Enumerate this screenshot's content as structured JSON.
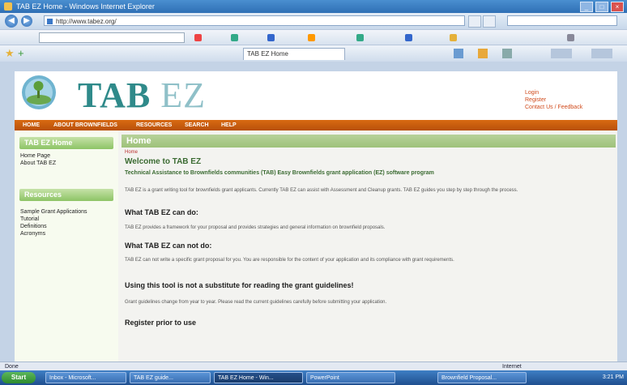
{
  "browser": {
    "title": "TAB EZ Home - Windows Internet Explorer",
    "address": "http://www.tabez.org/",
    "search_text": "",
    "google_query": "",
    "tab_title": "TAB EZ Home",
    "status_text": "Done",
    "zone_text": "Internet"
  },
  "site": {
    "brand_tab": "TAB",
    "brand_ez": "EZ",
    "top_links": [
      "Login",
      "Register",
      "Contact Us / Feedback"
    ],
    "nav": [
      "HOME",
      "ABOUT BROWNFIELDS",
      "RESOURCES",
      "SEARCH",
      "HELP"
    ]
  },
  "sidebar": {
    "section1_title": "TAB EZ Home",
    "section1_links": [
      "Home Page",
      "About TAB EZ"
    ],
    "section2_title": "Resources",
    "section2_links": [
      "Sample Grant Applications",
      "Tutorial",
      "Definitions",
      "Acronyms"
    ]
  },
  "content": {
    "heading": "Home",
    "breadcrumb": "Home",
    "welcome": "Welcome to TAB EZ",
    "subtitle": "Technical Assistance to Brownfields communities (TAB) Easy Brownfields grant application (EZ) software program",
    "intro": "TAB EZ is a grant writing tool for brownfields grant applicants. Currently TAB EZ can assist with Assessment and Cleanup grants. TAB EZ guides you step by step through the process.",
    "sections": [
      {
        "title": "What TAB EZ can do:",
        "text": "TAB EZ provides a framework for your proposal and provides strategies and general information on brownfield proposals."
      },
      {
        "title": "What TAB EZ can not do:",
        "text": "TAB EZ can not write a specific grant proposal for you. You are responsible for the content of your application and its compliance with grant requirements."
      },
      {
        "title": "Using this tool is not a substitute for reading the grant guidelines!",
        "text": "Grant guidelines change from year to year. Please read the current guidelines carefully before submitting your application."
      },
      {
        "title": "Register prior to use",
        "text": ""
      }
    ]
  },
  "taskbar": {
    "start": "Start",
    "tasks": [
      "Inbox - Microsoft...",
      "TAB EZ guide...",
      "TAB EZ Home - Win...",
      "PowerPoint",
      "Brownfield Proposal..."
    ],
    "clock": "3:21 PM"
  }
}
